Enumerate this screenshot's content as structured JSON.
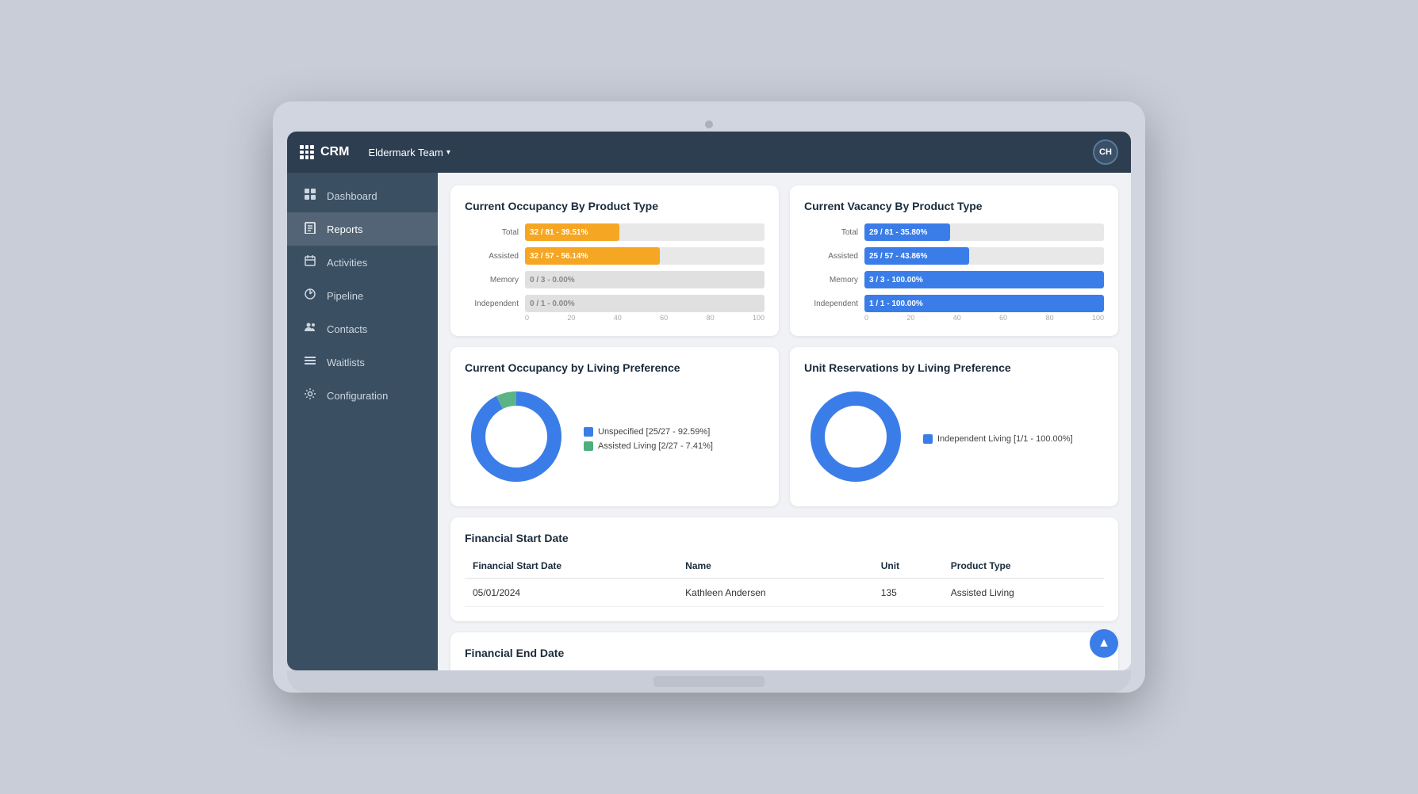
{
  "topbar": {
    "logo": "CRM",
    "team": "Eldermark Team",
    "chevron": "▾",
    "avatar": "CH"
  },
  "sidebar": {
    "items": [
      {
        "id": "dashboard",
        "label": "Dashboard",
        "icon": "📊"
      },
      {
        "id": "reports",
        "label": "Reports",
        "icon": "📄"
      },
      {
        "id": "activities",
        "label": "Activities",
        "icon": "📅"
      },
      {
        "id": "pipeline",
        "label": "Pipeline",
        "icon": "🕐"
      },
      {
        "id": "contacts",
        "label": "Contacts",
        "icon": "👥"
      },
      {
        "id": "waitlists",
        "label": "Waitlists",
        "icon": "☰"
      },
      {
        "id": "configuration",
        "label": "Configuration",
        "icon": "⚙️"
      }
    ]
  },
  "occupancy_bar_chart": {
    "title": "Current Occupancy By Product Type",
    "bars": [
      {
        "label": "Total",
        "text": "32 / 81 - 39.51%",
        "pct": 39.51,
        "color": "orange"
      },
      {
        "label": "Assisted",
        "text": "32 / 57 - 56.14%",
        "pct": 56.14,
        "color": "orange"
      },
      {
        "label": "Memory",
        "text": "0 / 3 - 0.00%",
        "pct": 0,
        "color": "gray"
      },
      {
        "label": "Independent",
        "text": "0 / 1 - 0.00%",
        "pct": 0,
        "color": "gray"
      }
    ],
    "axis": [
      "0",
      "20",
      "40",
      "60",
      "80",
      "100"
    ]
  },
  "vacancy_bar_chart": {
    "title": "Current Vacancy By Product Type",
    "bars": [
      {
        "label": "Total",
        "text": "29 / 81 - 35.80%",
        "pct": 35.8,
        "color": "blue"
      },
      {
        "label": "Assisted",
        "text": "25 / 57 - 43.86%",
        "pct": 43.86,
        "color": "blue"
      },
      {
        "label": "Memory",
        "text": "3 / 3 - 100.00%",
        "pct": 100,
        "color": "blue"
      },
      {
        "label": "Independent",
        "text": "1 / 1 - 100.00%",
        "pct": 100,
        "color": "blue"
      }
    ],
    "axis": [
      "0",
      "20",
      "40",
      "60",
      "80",
      "100"
    ]
  },
  "occupancy_donut": {
    "title": "Current Occupancy by Living Preference",
    "segments": [
      {
        "label": "Unspecified [25/27 - 92.59%]",
        "color": "#3b7de8",
        "pct": 92.59
      },
      {
        "label": "Assisted Living [2/27 - 7.41%]",
        "color": "#4caf7d",
        "pct": 7.41
      }
    ]
  },
  "reservation_donut": {
    "title": "Unit Reservations by Living Preference",
    "segments": [
      {
        "label": "Independent Living [1/1 - 100.00%]",
        "color": "#3b7de8",
        "pct": 100
      }
    ]
  },
  "financial_start": {
    "title": "Financial Start Date",
    "columns": [
      "Financial Start Date",
      "Name",
      "Unit",
      "Product Type"
    ],
    "rows": [
      {
        "date": "05/01/2024",
        "name": "Kathleen Andersen",
        "unit": "135",
        "product": "Assisted Living"
      }
    ]
  },
  "financial_end": {
    "title": "Financial End Date"
  }
}
